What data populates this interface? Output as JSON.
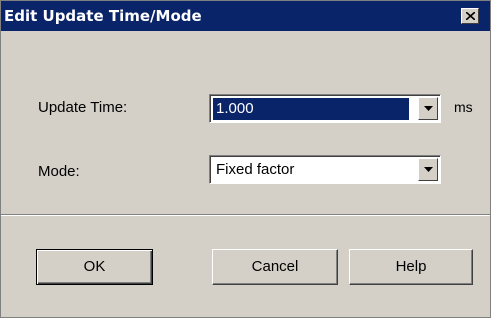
{
  "window": {
    "title": "Edit Update Time/Mode",
    "close_icon": "close-icon"
  },
  "update_time": {
    "label": "Update Time:",
    "value": "1.000",
    "unit": "ms"
  },
  "mode": {
    "label": "Mode:",
    "value": "Fixed factor"
  },
  "buttons": {
    "ok": "OK",
    "cancel": "Cancel",
    "help": "Help"
  },
  "colors": {
    "titlebar": "#0a246a",
    "face": "#d4d0c8",
    "selection": "#0a246a"
  }
}
